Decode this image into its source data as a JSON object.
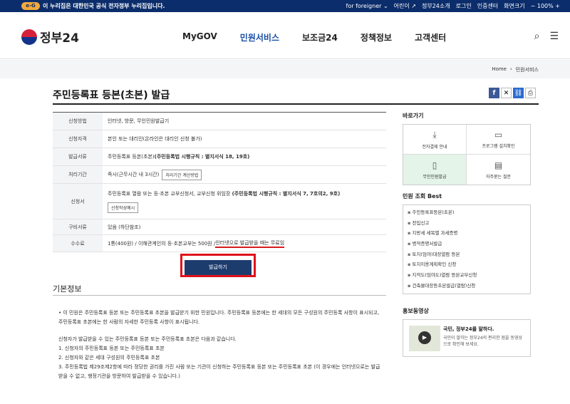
{
  "topbar": {
    "mark": "e-G",
    "notice": "이 누리집은 대한민국 공식 전자정부 누리집입니다.",
    "links": [
      "for foreigner ⌄",
      "어린이 ↗",
      "정부24소개",
      "로그인",
      "인증센터",
      "화면크기",
      "− 100% +"
    ]
  },
  "header": {
    "logo": "정부24",
    "nav": [
      "MyGOV",
      "민원서비스",
      "보조금24",
      "정책정보",
      "고객센터"
    ],
    "active_nav": "민원서비스"
  },
  "breadcrumb": [
    "Home",
    "민원서비스"
  ],
  "page_title": "주민등록표 등본(초본) 발급",
  "info": {
    "method_th": "신청방법",
    "method": "인터넷, 방문, 무인민원발급기",
    "qualification_th": "신청자격",
    "qualification": "본인 또는 대리인(온라인은 대리인 신청 불가)",
    "doc_th": "발급서류",
    "doc": "주민등록표 등본(초본)",
    "doc_law": "(주민등록법 시행규칙 : 별지서식 18, 19호)",
    "period_th": "처리기간",
    "period": "즉시(근무시간 내 3시간)",
    "period_btn": "처리기간 계산방법",
    "form_th": "신청서",
    "form": "주민등록표 열람 또는 등·초본 교부신청서, 교부신청 위임장",
    "form_law": "(주민등록법 시행규칙 : 별지서식 7, 7호의2, 9호)",
    "form_btn": "신청작성예시",
    "docs_th": "구비서류",
    "docs": "있음 (하단참조)",
    "fee_th": "수수료",
    "fee": "1통(400원) / 이해관계인의 등·초본교부는 500원 / ",
    "fee_free": "인터넷으로 발급받을 때는 무료임"
  },
  "issue_button": "발급하기",
  "basic_info": {
    "title": "기본정보",
    "p1": "• 이 민원은 주민등록표 등본 또는 주민등록표 초본을 발급받기 위한 민원입니다. 주민등록표 등본에는 한 세대의 모든 구성원의 주민등록 사항이 표시되고, 주민등록표 초본에는 한 사람의 자세한 주민등록 사항이 표시됩니다.",
    "p2": "신청자가 발급받을 수 있는 주민등록표 등본 또는 주민등록표 초본은 다음과 같습니다.",
    "l1": "1. 신청자의 주민등록표 등본 또는 주민등록표 초본",
    "l2": "2. 신청자와 같은 세대 구성원의 주민등록표 초본",
    "l3": "3. 주민등록법 제29조제2항에 따라 정당한 권리를 가진 사람 또는 기관이 신청하는 주민등록표 등본 또는 주민등록표 초본 (이 경우에는 인터넷으로는 발급받을 수 없고, 행정기관을 방문하여 발급받을 수 있습니다.)"
  },
  "sidebar": {
    "quick_title": "바로가기",
    "quick": [
      {
        "icon": "download-icon",
        "glyph": "⤓",
        "label": "전자결제 안내"
      },
      {
        "icon": "monitor-icon",
        "glyph": "▭",
        "label": "프로그램 설치확인"
      },
      {
        "icon": "kiosk-icon",
        "glyph": "▯",
        "label": "무인민원발급"
      },
      {
        "icon": "chat-icon",
        "glyph": "▤",
        "label": "자주묻는 질문"
      }
    ],
    "best_title": "민원 조회 Best",
    "best": [
      "주민등록표등본(초본)",
      "전입신고",
      "지방세 세목별 과세증명",
      "병적증명서발급",
      "토지(임야)대장열람 등본",
      "토지이용계획확인 신청",
      "지적도(임야도)열람 등본교부신청",
      "건축물대장등초본발급(열람)신청"
    ],
    "video_title": "홍보동영상",
    "video_head": "국민, 정부24를 말하다.",
    "video_desc": "국민이 말하는 정부24의 편리한 점을 동영상으로 확인해 보세요."
  }
}
